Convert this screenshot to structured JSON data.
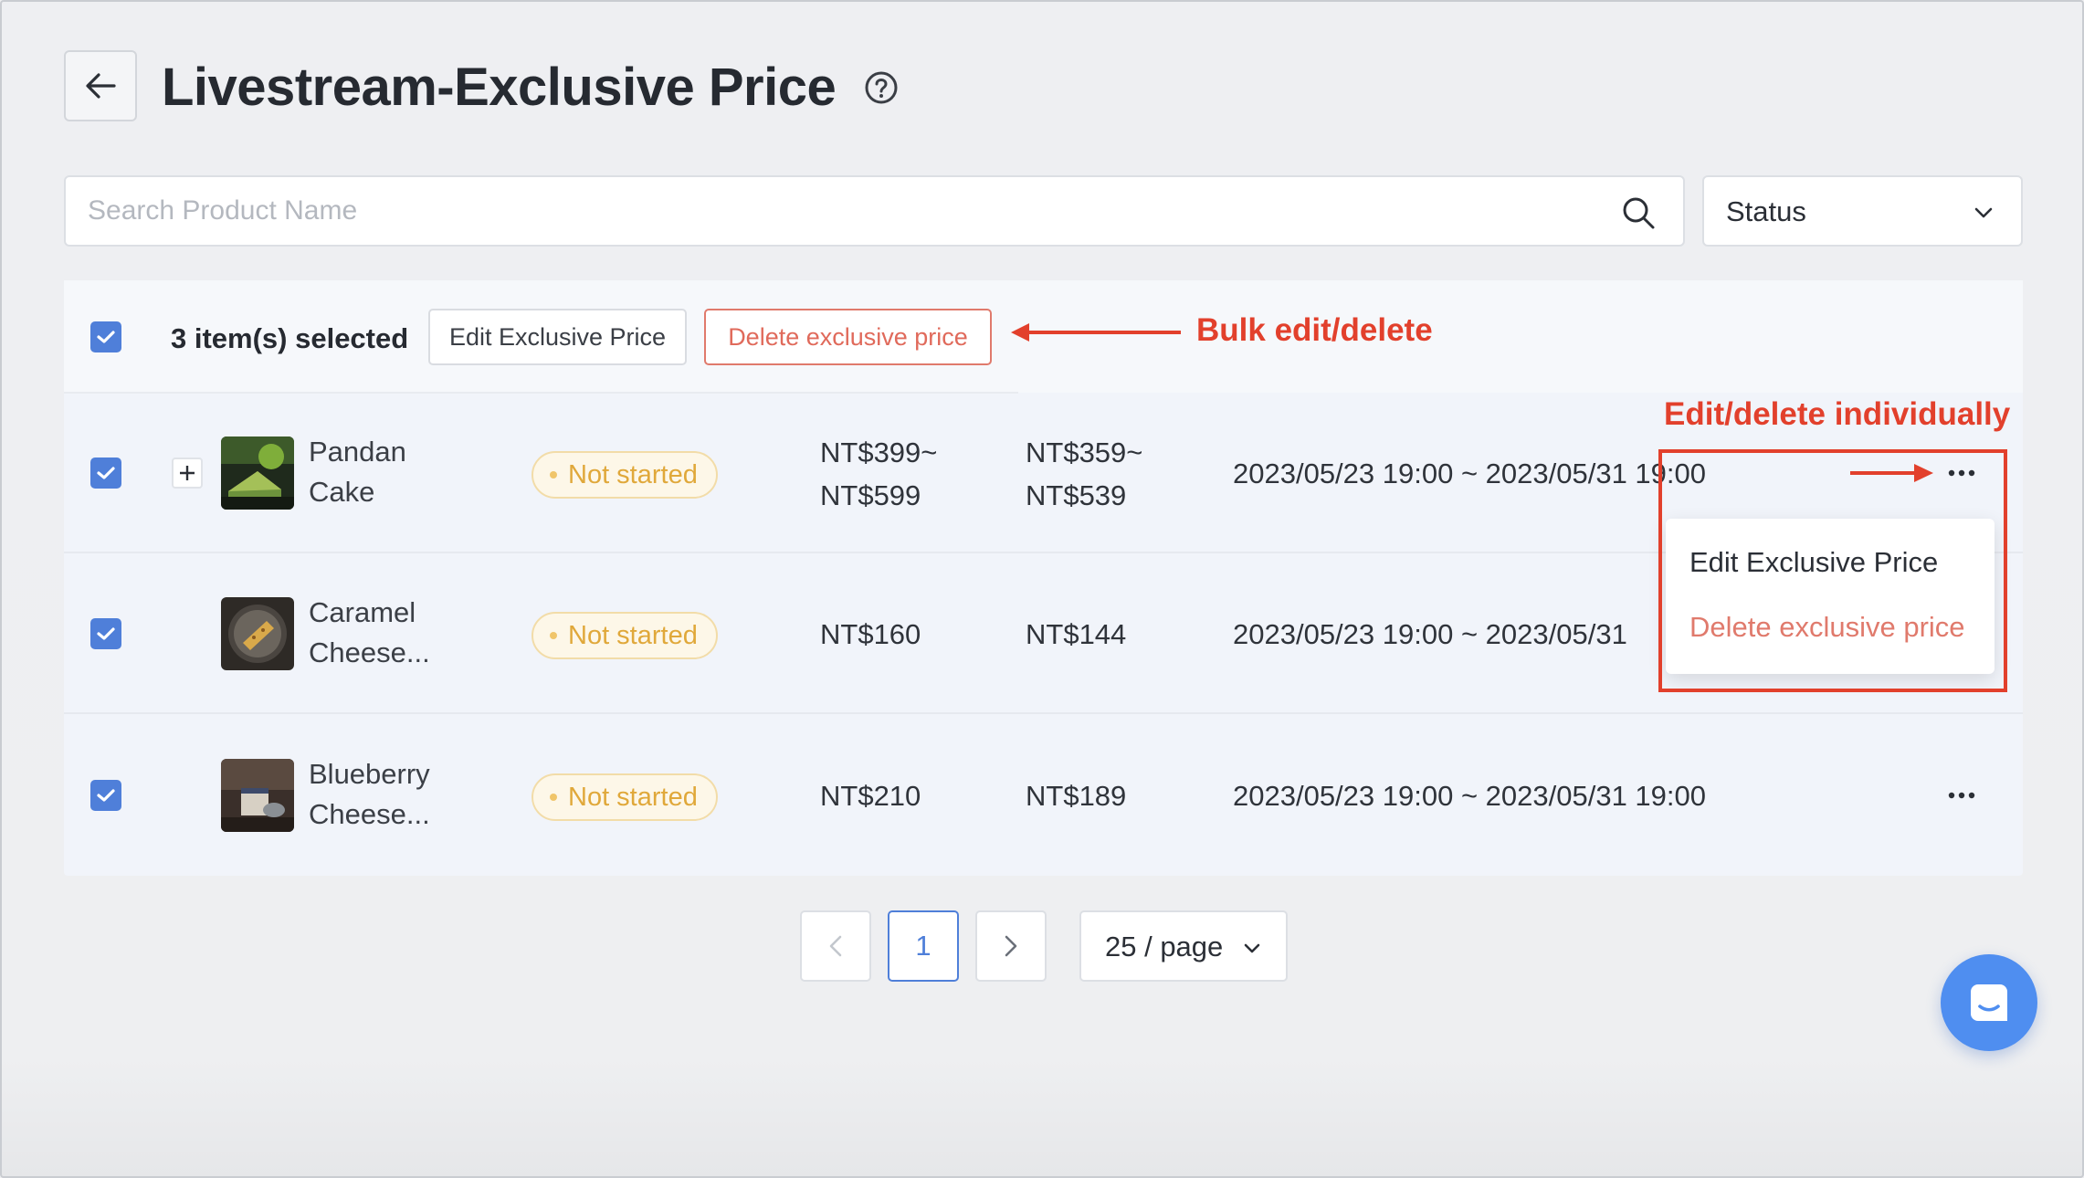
{
  "header": {
    "title": "Livestream-Exclusive Price"
  },
  "filters": {
    "search_placeholder": "Search Product Name",
    "status_label": "Status"
  },
  "bulk_bar": {
    "selected_text": "3 item(s) selected",
    "edit_label": "Edit Exclusive Price",
    "delete_label": "Delete exclusive price"
  },
  "rows": [
    {
      "name_line1": "Pandan",
      "name_line2": "Cake",
      "status": "Not started",
      "original_price_line1": "NT$399~",
      "original_price_line2": "NT$599",
      "exclusive_price_line1": "NT$359~",
      "exclusive_price_line2": "NT$539",
      "period": "2023/05/23 19:00 ~ 2023/05/31 19:00",
      "checked": true,
      "expandable": true
    },
    {
      "name_line1": "Caramel",
      "name_line2": "Cheese...",
      "status": "Not started",
      "original_price": "NT$160",
      "exclusive_price": "NT$144",
      "period": "2023/05/23 19:00 ~ 2023/05/31",
      "checked": true
    },
    {
      "name_line1": "Blueberry",
      "name_line2": "Cheese...",
      "status": "Not started",
      "original_price": "NT$210",
      "exclusive_price": "NT$189",
      "period": "2023/05/23 19:00 ~ 2023/05/31 19:00",
      "checked": true
    }
  ],
  "row_menu": {
    "edit_label": "Edit Exclusive Price",
    "delete_label": "Delete exclusive price"
  },
  "annotations": {
    "bulk": "Bulk edit/delete",
    "individual": "Edit/delete individually"
  },
  "pagination": {
    "current_page": "1",
    "page_size": "25 / page"
  },
  "colors": {
    "accent": "#4f7fd9",
    "danger": "#e06a5b",
    "annotation": "#e2402c",
    "status_pending": "#e0a83a"
  }
}
